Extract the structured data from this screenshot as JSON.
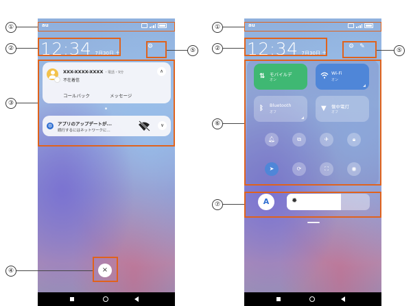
{
  "status_bar": {
    "carrier": "au"
  },
  "clock": {
    "time": "12:34",
    "date": "7月30日 土"
  },
  "notifications": {
    "missed_call": {
      "caller": "XXX-XXXX-XXXX",
      "meta": "・電話・9分",
      "status": "不在着信",
      "action_callback": "コールバック",
      "action_message": "メッセージ"
    },
    "app_update": {
      "title": "アプリのアップデートが...",
      "subtitle": "続行するにはネットワークに..."
    }
  },
  "control_center": {
    "tiles": [
      {
        "label": "モバイルデ",
        "sub": "オン",
        "icon": "mobile-data-icon",
        "color": "#3fb873"
      },
      {
        "label": "Wi-Fi",
        "sub": "オン",
        "icon": "wifi-icon",
        "color": "#4f86d8"
      },
      {
        "label": "Bluetooth",
        "sub": "オフ",
        "icon": "bluetooth-icon"
      },
      {
        "label": "懐中電灯",
        "sub": "オフ",
        "icon": "flashlight-icon"
      }
    ],
    "toggles_row1": [
      "bell-icon",
      "screenshot-icon",
      "airplane-icon",
      "lock-icon"
    ],
    "toggles_row2": [
      "location-icon",
      "rotation-lock-icon",
      "scan-icon",
      "eye-icon"
    ],
    "auto_brightness_label": "A",
    "brightness_level_percent": 65
  },
  "callouts": {
    "c1": "①",
    "c2": "②",
    "c3": "③",
    "c4": "④",
    "c5": "⑤",
    "c6": "⑥",
    "c7": "⑦"
  },
  "colors": {
    "accent": "#e0621b",
    "mobile_tile": "#3fb873",
    "wifi_tile": "#4f86d8"
  }
}
